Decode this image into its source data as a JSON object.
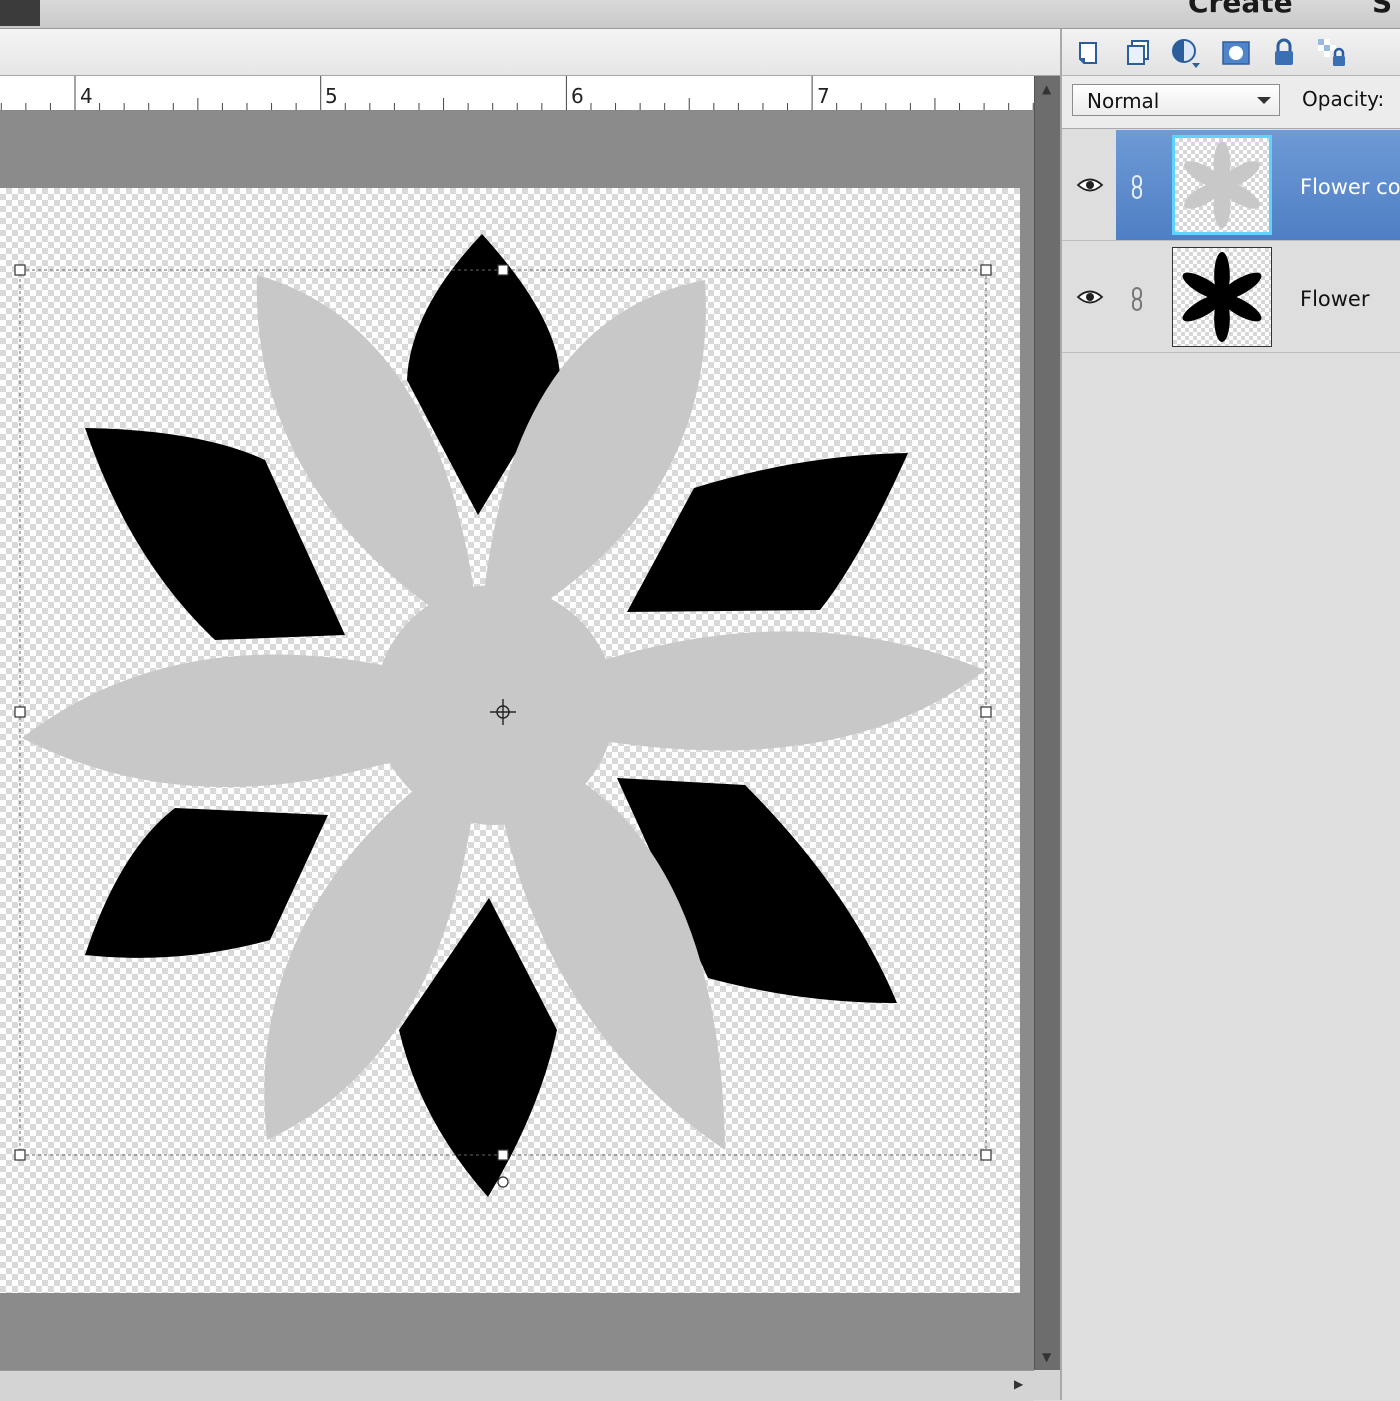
{
  "header": {
    "create_label": "Create",
    "clipped_label": "S"
  },
  "ruler": {
    "labels": [
      "4",
      "5",
      "6",
      "7"
    ]
  },
  "layers_panel": {
    "toolbar_icons": [
      "new-layer-icon",
      "duplicate-layer-icon",
      "adjustment-layer-icon",
      "layer-mask-icon",
      "lock-all-icon",
      "lock-transparency-icon"
    ],
    "blend_mode": "Normal",
    "opacity_label": "Opacity:",
    "layers": [
      {
        "name": "Flower cop",
        "selected": true,
        "visible": true,
        "fill": "#c8c7c8"
      },
      {
        "name": "Flower",
        "selected": false,
        "visible": true,
        "fill": "#000000"
      }
    ]
  },
  "colors": {
    "selection_blue": "#5b8acb",
    "grey_petals": "#c9c8c9",
    "black_petals": "#000000"
  }
}
